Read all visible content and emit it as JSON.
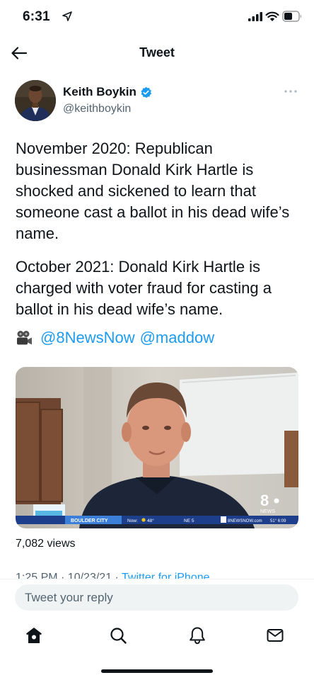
{
  "status_bar": {
    "time": "6:31"
  },
  "header": {
    "title": "Tweet"
  },
  "author": {
    "name": "Keith Boykin",
    "handle": "@keithboykin",
    "verified": true
  },
  "tweet": {
    "paragraph_1": "November 2020: Republican businessman Donald Kirk Hartle is shocked and sickened to learn that someone cast a ballot in his dead wife’s name.",
    "paragraph_2": "October 2021: Donald Kirk Hartle is charged with voter fraud for casting a ballot in his dead wife’s name.",
    "mentions": [
      "@8NewsNow",
      "@maddow"
    ]
  },
  "video": {
    "ticker_location": "BOULDER CITY",
    "ticker_now": "Now:",
    "ticker_temp": "48°",
    "ticker_wind": "NE 5",
    "ticker_site": "8NEWSNOW.com",
    "ticker_time": "51° 6:09",
    "logo_number": "8",
    "logo_text": "NEWS"
  },
  "stats": {
    "views": "7,082 views"
  },
  "meta": {
    "time": "1:25 PM · 10/23/21 · ",
    "source": "Twitter for iPhone"
  },
  "reply": {
    "placeholder": "Tweet your reply"
  },
  "tabs": [
    "home-icon",
    "search-icon",
    "notifications-icon",
    "messages-icon"
  ],
  "colors": {
    "accent": "#1d9bf0",
    "text": "#0f1419",
    "secondary": "#536471",
    "surface": "#eff3f4"
  }
}
